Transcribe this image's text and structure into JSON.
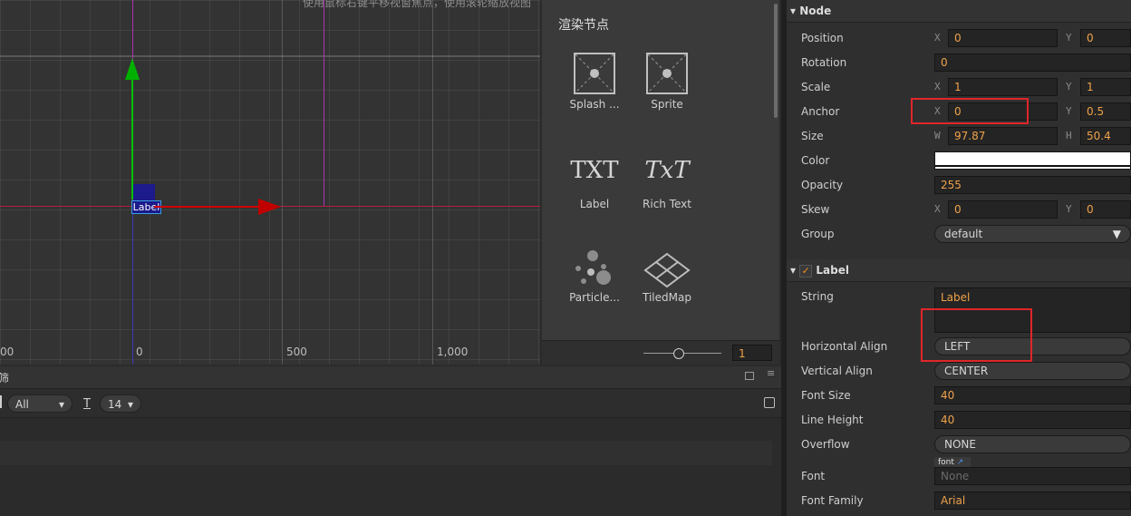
{
  "scene": {
    "hint_text": "使用鼠标右键平移视窗焦点，使用滚轮缩放视图",
    "axis_labels": [
      "00",
      "0",
      "500",
      "1,000"
    ],
    "node_label": "Label"
  },
  "library": {
    "title": "渲染节点",
    "items": [
      {
        "label": "Splash ...",
        "icon": "splash-icon"
      },
      {
        "label": "Sprite",
        "icon": "sprite-icon"
      },
      {
        "label": "Label",
        "icon": "txt-icon",
        "glyph": "TXT"
      },
      {
        "label": "Rich Text",
        "icon": "rich-text-icon",
        "glyph": "TxT"
      },
      {
        "label": "Particle...",
        "icon": "particle-icon"
      },
      {
        "label": "TiledMap",
        "icon": "tiledmap-icon"
      }
    ],
    "zoom_value": "1"
  },
  "console": {
    "tab_label": "筛",
    "filter_value": "All",
    "font_icon": "T",
    "font_size_value": "14"
  },
  "inspector": {
    "node_section": "Node",
    "label_section": "Label",
    "props": {
      "position": {
        "label": "Position",
        "x": "0",
        "y": "0"
      },
      "rotation": {
        "label": "Rotation",
        "value": "0"
      },
      "scale": {
        "label": "Scale",
        "x": "1",
        "y": "1"
      },
      "anchor": {
        "label": "Anchor",
        "x": "0",
        "y": "0.5"
      },
      "size": {
        "label": "Size",
        "w": "97.87",
        "h": "50.4"
      },
      "color": {
        "label": "Color",
        "value": "#ffffff"
      },
      "opacity": {
        "label": "Opacity",
        "value": "255"
      },
      "skew": {
        "label": "Skew",
        "x": "0",
        "y": "0"
      },
      "group": {
        "label": "Group",
        "value": "default"
      }
    },
    "label_props": {
      "string": {
        "label": "String",
        "value": "Label"
      },
      "halign": {
        "label": "Horizontal Align",
        "value": "LEFT"
      },
      "valign": {
        "label": "Vertical Align",
        "value": "CENTER"
      },
      "font_size": {
        "label": "Font Size",
        "value": "40"
      },
      "line_height": {
        "label": "Line Height",
        "value": "40"
      },
      "overflow": {
        "label": "Overflow",
        "value": "NONE"
      },
      "font": {
        "label": "Font",
        "tag": "font",
        "value": "None"
      },
      "font_family": {
        "label": "Font Family",
        "value": "Arial"
      }
    },
    "axis_letters": {
      "x": "X",
      "y": "Y",
      "w": "W",
      "h": "H"
    }
  },
  "colors": {
    "value_orange": "#f0a24a",
    "highlight_red": "#e0262a",
    "axis_green": "#00c000",
    "axis_red": "#d00000",
    "guide_magenta": "#b030b0",
    "checkbox_orange": "#f09020"
  }
}
